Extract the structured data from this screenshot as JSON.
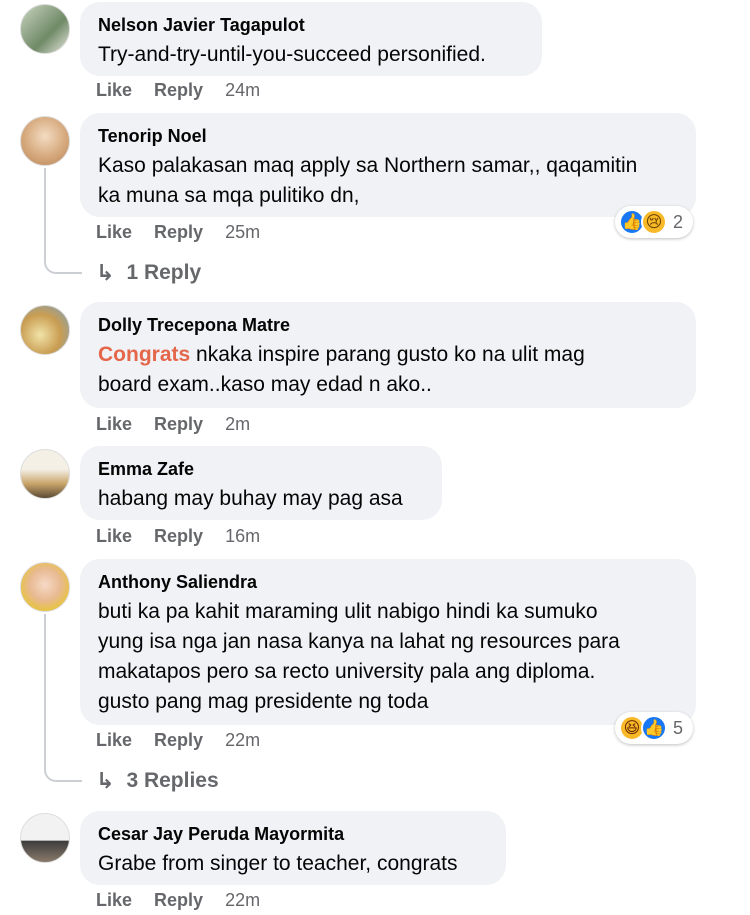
{
  "labels": {
    "like": "Like",
    "reply": "Reply"
  },
  "comments": [
    {
      "name": "Nelson Javier Tagapulot",
      "text": "Try-and-try-until-you-succeed personified.",
      "time": "24m"
    },
    {
      "name": "Tenorip Noel",
      "text": "Kaso palakasan maq apply sa Northern samar,, qaqamitin\nka muna sa mqa pulitiko dn,",
      "time": "25m",
      "reaction_count": "2",
      "replies": "1 Reply"
    },
    {
      "name": "Dolly Trecepona Matre",
      "highlight": "Congrats",
      "text": " nkaka inspire parang gusto ko na ulit mag\nboard exam..kaso may edad n ako..",
      "time": "2m"
    },
    {
      "name": "Emma Zafe",
      "text": "habang may buhay may pag asa",
      "time": "16m"
    },
    {
      "name": "Anthony Saliendra",
      "text": "buti ka pa kahit maraming ulit nabigo hindi ka sumuko\nyung isa nga jan nasa kanya na lahat ng resources para\nmakatapos pero sa recto university pala ang diploma.\ngusto pang mag presidente ng toda",
      "time": "22m",
      "reaction_count": "5",
      "replies": "3 Replies"
    },
    {
      "name": "Cesar Jay Peruda Mayormita",
      "text": "Grabe from singer to teacher, congrats",
      "time": "22m"
    }
  ],
  "colors": {
    "bubble": "#f0f2f5",
    "highlight": "#e4664b",
    "meta": "#65676b",
    "like": "#1877f2"
  },
  "icons": {
    "like": "like-reaction-icon",
    "sad": "sad-reaction-icon",
    "haha": "haha-reaction-icon",
    "reply_arrow": "reply-arrow-icon"
  }
}
